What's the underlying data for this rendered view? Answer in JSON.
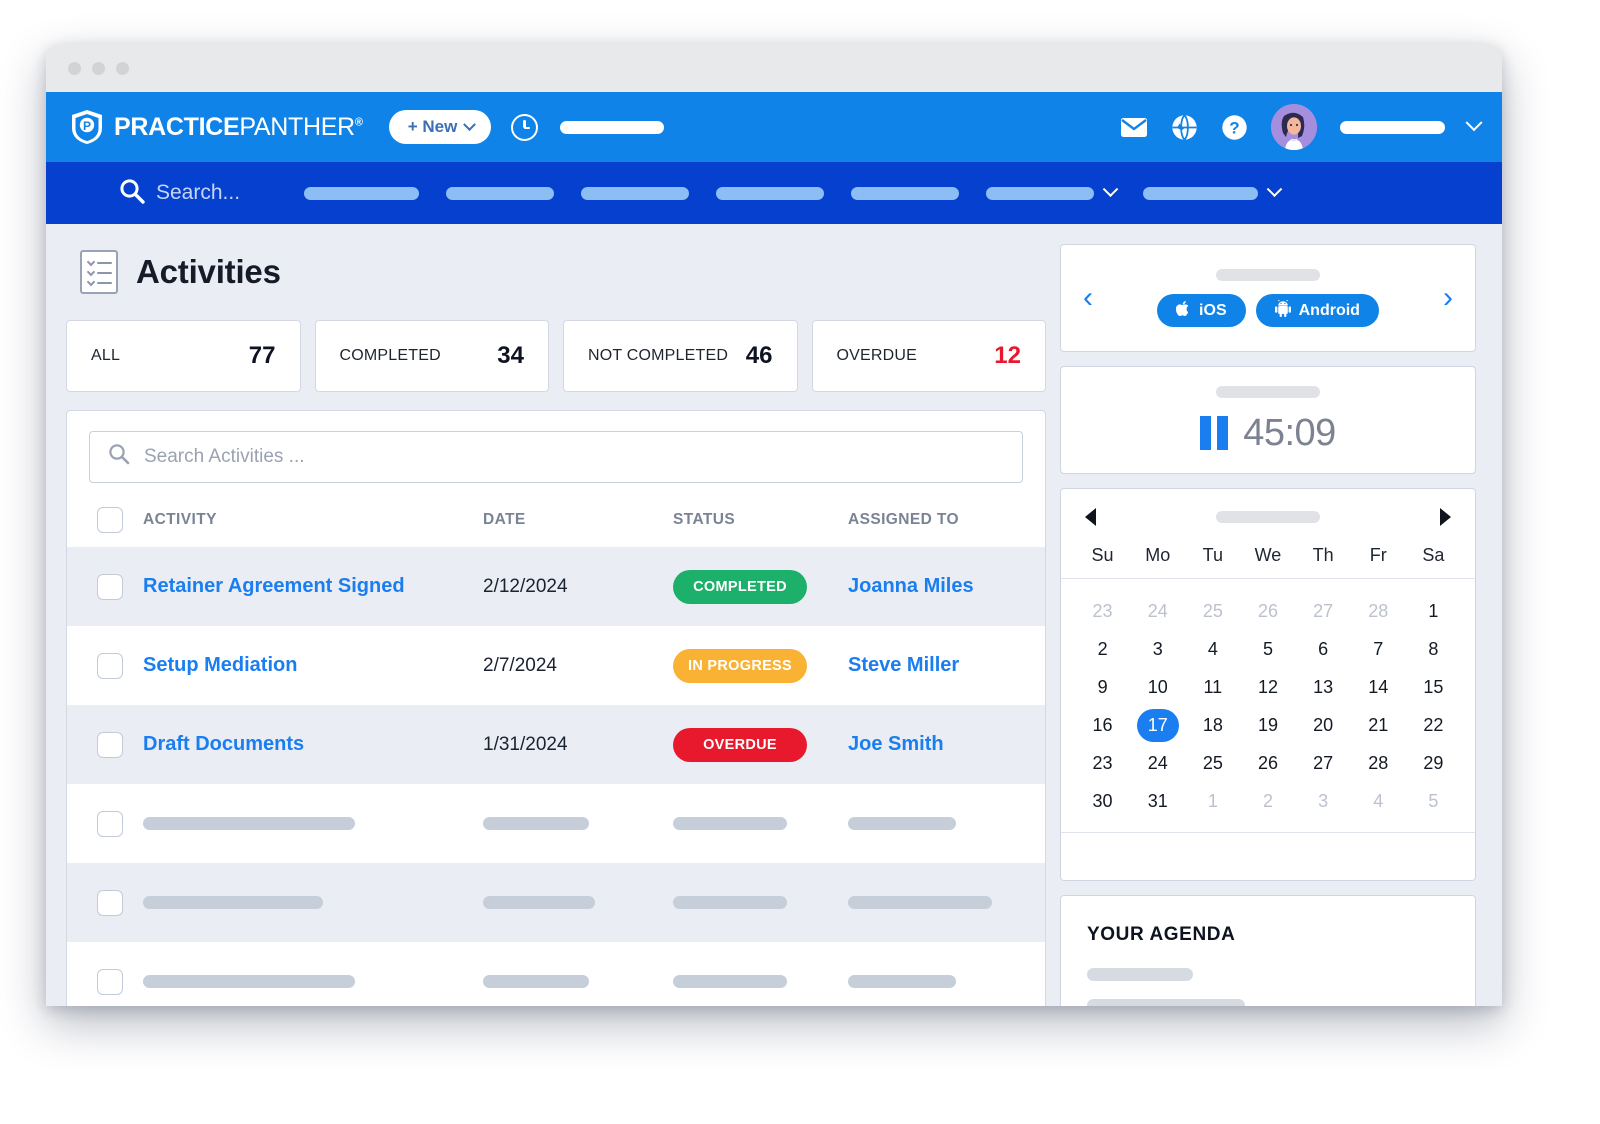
{
  "brand": {
    "name_bold": "PRACTICE",
    "name_thin": "PANTHER",
    "registered": "®",
    "blue": "#0f83e8",
    "navy": "#0540ce"
  },
  "topbar": {
    "new_button": "+ New",
    "icons": [
      "clock-icon",
      "mail-icon",
      "globe-icon",
      "help-icon"
    ],
    "avatar_alt": "user-avatar"
  },
  "navbar": {
    "search_placeholder": "Search..."
  },
  "page": {
    "title": "Activities",
    "icon": "checklist-icon"
  },
  "stats": [
    {
      "label": "ALL",
      "value": "77",
      "accent": "#0d1320"
    },
    {
      "label": "COMPLETED",
      "value": "34",
      "accent": "#0d1320"
    },
    {
      "label": "NOT COMPLETED",
      "value": "46",
      "accent": "#0d1320"
    },
    {
      "label": "OVERDUE",
      "value": "12",
      "accent": "#e8192c"
    }
  ],
  "table": {
    "search_placeholder": "Search Activities ...",
    "columns": [
      "ACTIVITY",
      "DATE",
      "STATUS",
      "ASSIGNED TO"
    ],
    "rows": [
      {
        "activity": "Retainer Agreement Signed",
        "date": "2/12/2024",
        "status": "COMPLETED",
        "status_color": "#1db06a",
        "assigned": "Joanna Miles"
      },
      {
        "activity": "Setup Mediation",
        "date": "2/7/2024",
        "status": "IN PROGRESS",
        "status_color": "#f9b233",
        "assigned": "Steve Miller"
      },
      {
        "activity": "Draft Documents",
        "date": "1/31/2024",
        "status": "OVERDUE",
        "status_color": "#e8192c",
        "assigned": "Joe Smith"
      }
    ]
  },
  "apps_panel": {
    "ios_label": "iOS",
    "android_label": "Android",
    "prev": "‹",
    "next": "›"
  },
  "timer_panel": {
    "time": "45:09",
    "state": "paused"
  },
  "calendar": {
    "prev": "◀",
    "next": "▶",
    "dow": [
      "Su",
      "Mo",
      "Tu",
      "We",
      "Th",
      "Fr",
      "Sa"
    ],
    "weeks": [
      [
        {
          "d": "23",
          "m": true
        },
        {
          "d": "24",
          "m": true
        },
        {
          "d": "25",
          "m": true
        },
        {
          "d": "26",
          "m": true
        },
        {
          "d": "27",
          "m": true
        },
        {
          "d": "28",
          "m": true
        },
        {
          "d": "1"
        }
      ],
      [
        {
          "d": "2"
        },
        {
          "d": "3"
        },
        {
          "d": "4"
        },
        {
          "d": "5"
        },
        {
          "d": "6"
        },
        {
          "d": "7"
        },
        {
          "d": "8"
        }
      ],
      [
        {
          "d": "9"
        },
        {
          "d": "10"
        },
        {
          "d": "11"
        },
        {
          "d": "12"
        },
        {
          "d": "13"
        },
        {
          "d": "14"
        },
        {
          "d": "15"
        }
      ],
      [
        {
          "d": "16"
        },
        {
          "d": "17",
          "sel": true
        },
        {
          "d": "18"
        },
        {
          "d": "19"
        },
        {
          "d": "20"
        },
        {
          "d": "21"
        },
        {
          "d": "22"
        }
      ],
      [
        {
          "d": "23"
        },
        {
          "d": "24"
        },
        {
          "d": "25"
        },
        {
          "d": "26"
        },
        {
          "d": "27"
        },
        {
          "d": "28"
        },
        {
          "d": "29"
        }
      ],
      [
        {
          "d": "30"
        },
        {
          "d": "31"
        },
        {
          "d": "1",
          "m": true
        },
        {
          "d": "2",
          "m": true
        },
        {
          "d": "3",
          "m": true
        },
        {
          "d": "4",
          "m": true
        },
        {
          "d": "5",
          "m": true
        }
      ]
    ]
  },
  "agenda": {
    "title": "YOUR AGENDA"
  }
}
